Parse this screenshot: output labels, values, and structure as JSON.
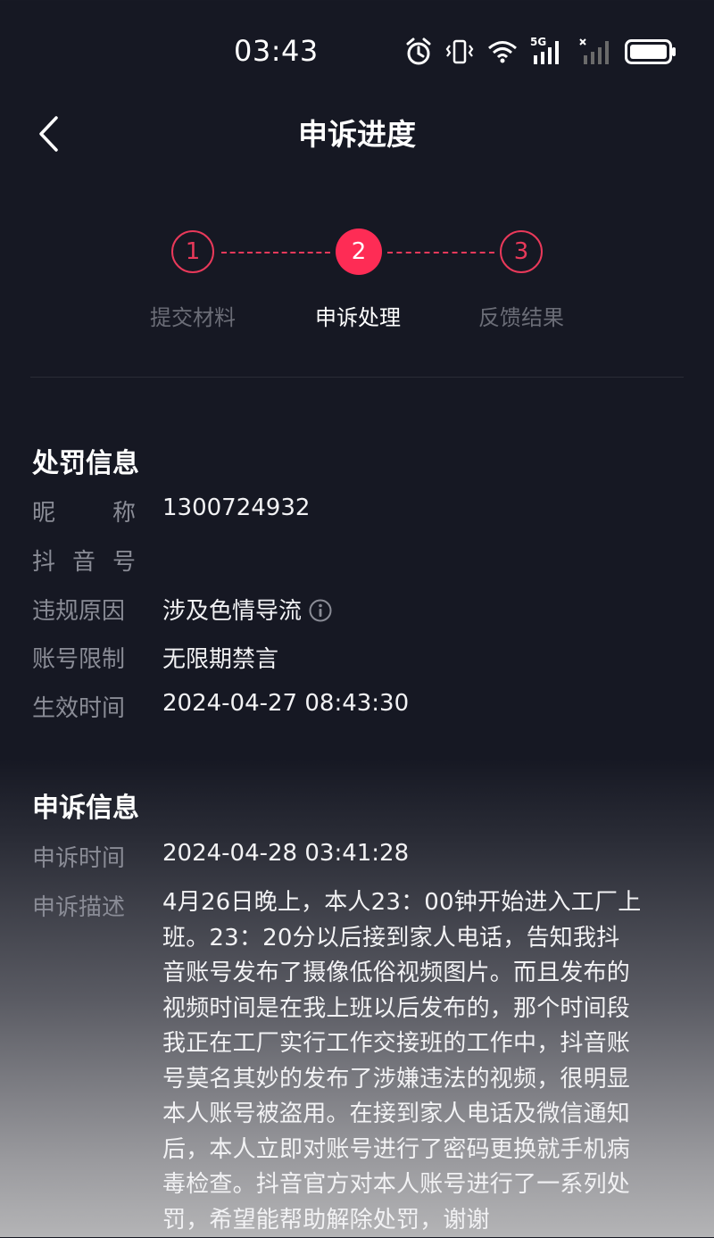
{
  "status_bar": {
    "time": "03:43",
    "network": "5G"
  },
  "nav": {
    "title": "申诉进度"
  },
  "stepper": {
    "steps": [
      {
        "number": "1",
        "label": "提交材料",
        "state": "done"
      },
      {
        "number": "2",
        "label": "申诉处理",
        "state": "current"
      },
      {
        "number": "3",
        "label": "反馈结果",
        "state": "pending"
      }
    ],
    "accent_color": "#fe2c55"
  },
  "penalty": {
    "title": "处罚信息",
    "rows": [
      {
        "label_chars": [
          "昵",
          "称"
        ],
        "value": "1300724932"
      },
      {
        "label_chars": [
          "抖",
          "音",
          "号"
        ],
        "value": ""
      },
      {
        "label": "违规原因",
        "value": "涉及色情导流",
        "icon": "info-icon"
      },
      {
        "label": "账号限制",
        "value": "无限期禁言"
      },
      {
        "label": "生效时间",
        "value": "2024-04-27 08:43:30"
      }
    ]
  },
  "appeal": {
    "title": "申诉信息",
    "time_label": "申诉时间",
    "time_value": "2024-04-28 03:41:28",
    "desc_label": "申诉描述",
    "desc_lines": [
      "4月26日晚上，本人23：00钟开始进入工厂上",
      "班。23：20分以后接到家人电话，告知我抖",
      "音账号发布了摄像低俗视频图片。而且发布的",
      "视频时间是在我上班以后发布的，那个时间段",
      "我正在工厂实行工作交接班的工作中，抖音账",
      "号莫名其妙的发布了涉嫌违法的视频，很明显",
      "本人账号被盗用。在接到家人电话及微信通知",
      "后，本人立即对账号进行了密码更换就手机病",
      "毒检查。抖音官方对本人账号进行了一系列处",
      "罚，希望能帮助解除处罚，谢谢"
    ]
  },
  "colors": {
    "background": "#161823",
    "label": "#8a8c96",
    "accent": "#fe2c55"
  }
}
